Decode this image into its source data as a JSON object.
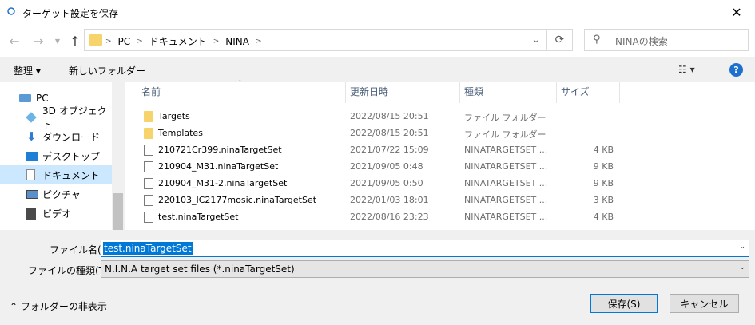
{
  "window": {
    "title": "ターゲット設定を保存",
    "close_glyph": "✕"
  },
  "nav": {
    "back_glyph": "←",
    "forward_glyph": "→",
    "up_glyph": "↑",
    "refresh_glyph": "⟳",
    "breadcrumb": [
      "PC",
      "ドキュメント",
      "NINA"
    ],
    "search_placeholder": "NINAの検索"
  },
  "toolbar": {
    "organize_label": "整理 ▾",
    "new_folder_label": "新しいフォルダー",
    "view_glyph": "☷ ▾",
    "help_glyph": "?"
  },
  "sidebar": {
    "items": [
      {
        "label": "PC",
        "icon": "pc-icon",
        "color": "#5b9bd5"
      },
      {
        "label": "3D オブジェクト",
        "icon": "3d-objects-icon",
        "color": "#6cb4e6"
      },
      {
        "label": "ダウンロード",
        "icon": "download-icon",
        "color": "#2e7bd6"
      },
      {
        "label": "デスクトップ",
        "icon": "desktop-icon",
        "color": "#1e7fd6"
      },
      {
        "label": "ドキュメント",
        "icon": "documents-icon",
        "color": "#8a8a8a",
        "selected": true
      },
      {
        "label": "ピクチャ",
        "icon": "pictures-icon",
        "color": "#5b8fc9"
      },
      {
        "label": "ビデオ",
        "icon": "videos-icon",
        "color": "#4a4a4a"
      }
    ]
  },
  "columns": {
    "name": "名前",
    "modified": "更新日時",
    "type": "種類",
    "size": "サイズ"
  },
  "files": [
    {
      "name": "Targets",
      "date": "2022/08/15 20:51",
      "type": "ファイル フォルダー",
      "size": "",
      "kind": "folder"
    },
    {
      "name": "Templates",
      "date": "2022/08/15 20:51",
      "type": "ファイル フォルダー",
      "size": "",
      "kind": "folder"
    },
    {
      "name": "210721Cr399.ninaTargetSet",
      "date": "2021/07/22 15:09",
      "type": "NINATARGETSET ...",
      "size": "4 KB",
      "kind": "file"
    },
    {
      "name": "210904_M31.ninaTargetSet",
      "date": "2021/09/05 0:48",
      "type": "NINATARGETSET ...",
      "size": "9 KB",
      "kind": "file"
    },
    {
      "name": "210904_M31-2.ninaTargetSet",
      "date": "2021/09/05 0:50",
      "type": "NINATARGETSET ...",
      "size": "9 KB",
      "kind": "file"
    },
    {
      "name": "220103_IC2177mosic.ninaTargetSet",
      "date": "2022/01/03 18:01",
      "type": "NINATARGETSET ...",
      "size": "3 KB",
      "kind": "file"
    },
    {
      "name": "test.ninaTargetSet",
      "date": "2022/08/16 23:23",
      "type": "NINATARGETSET ...",
      "size": "4 KB",
      "kind": "file"
    }
  ],
  "form": {
    "filename_label": "ファイル名(N):",
    "filename_value": "test.ninaTargetSet",
    "filetype_label": "ファイルの種類(T):",
    "filetype_value": "N.I.N.A target set files (*.ninaTargetSet)"
  },
  "footer": {
    "hide_folders_label": "⌃ フォルダーの非表示",
    "save_label": "保存(S)",
    "cancel_label": "キャンセル"
  },
  "colors": {
    "accent": "#0078d7",
    "selection": "#cce8ff",
    "folder": "#f7d46b"
  }
}
